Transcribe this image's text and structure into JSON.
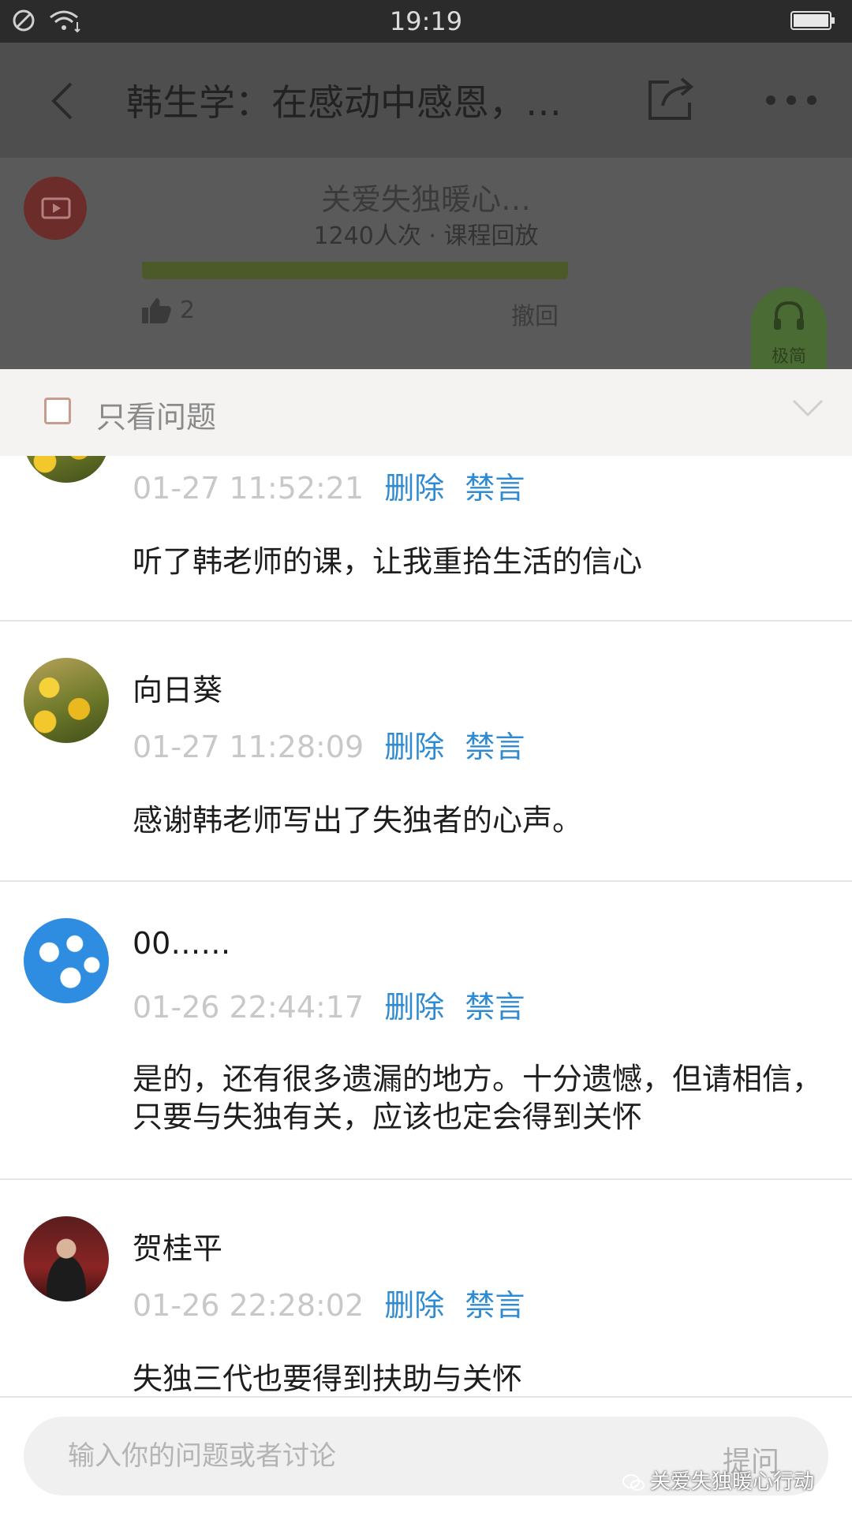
{
  "status_bar": {
    "time": "19:19"
  },
  "header": {
    "title": "韩生学：在感动中感恩，…",
    "course_name": "关爱失独暖心…",
    "course_meta": "1240人次 · 课程回放",
    "like_count": "2",
    "withdraw_label": "撤回",
    "audio_mode_label": "极简"
  },
  "filter": {
    "label": "只看问题",
    "checked": false
  },
  "comments": [
    {
      "username": "",
      "time": "01-27 11:52:21",
      "delete_label": "删除",
      "mute_label": "禁言",
      "text": "听了韩老师的课，让我重拾生活的信心"
    },
    {
      "username": "向日葵",
      "time": "01-27 11:28:09",
      "delete_label": "删除",
      "mute_label": "禁言",
      "text": "感谢韩老师写出了失独者的心声。"
    },
    {
      "username": "00……",
      "time": "01-26 22:44:17",
      "delete_label": "删除",
      "mute_label": "禁言",
      "text": "是的，还有很多遗漏的地方。十分遗憾，但请相信，只要与失独有关，应该也定会得到关怀"
    },
    {
      "username": "贺桂平",
      "time": "01-26 22:28:02",
      "delete_label": "删除",
      "mute_label": "禁言",
      "text": "失独三代也要得到扶助与关怀"
    }
  ],
  "input": {
    "placeholder": "输入你的问题或者讨论",
    "submit_label": "提问"
  },
  "watermark": "关爱失独暖心行动",
  "colors": {
    "link": "#2f8bd1",
    "timestamp": "#c8c8c8",
    "divider": "#e6e6e6"
  }
}
